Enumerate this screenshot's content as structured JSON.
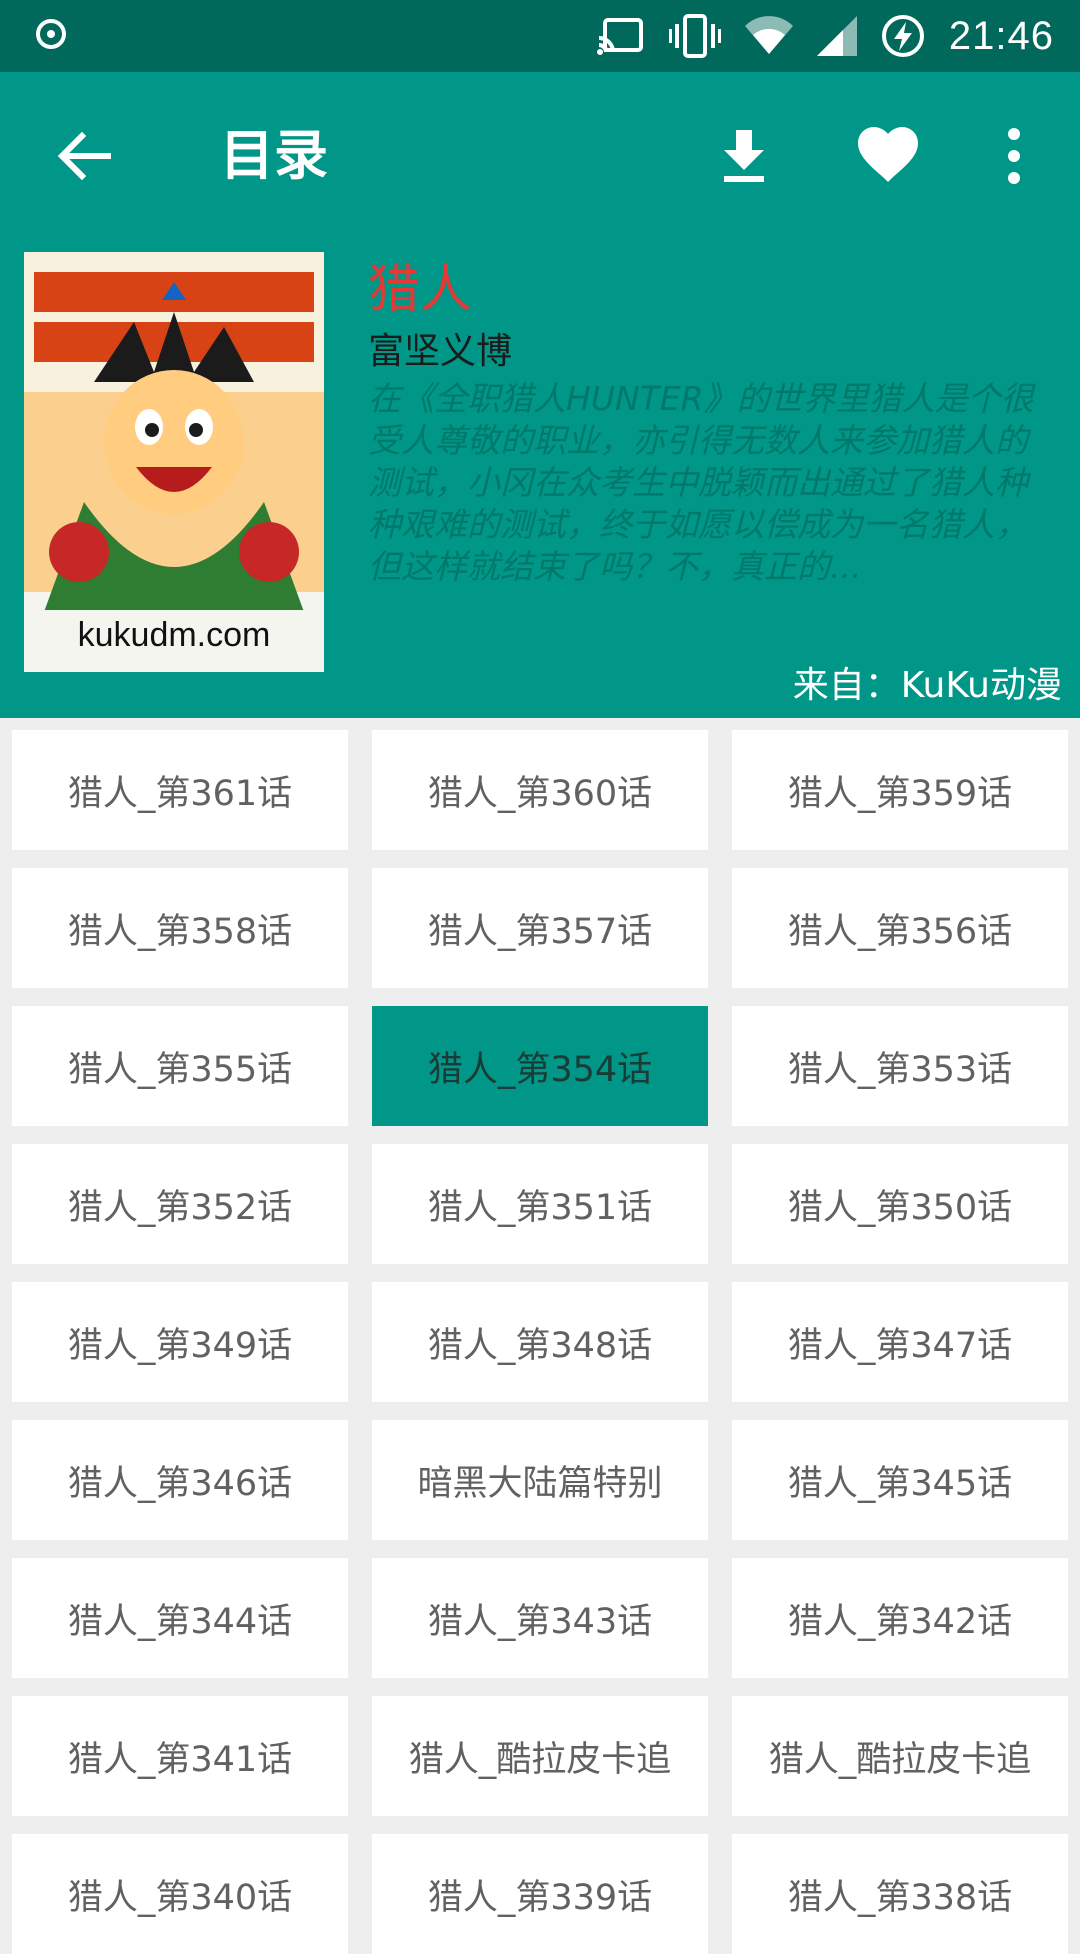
{
  "status_bar": {
    "time": "21:46",
    "icons": [
      "record-icon",
      "cast-icon",
      "vibrate-icon",
      "wifi-icon",
      "signal-icon",
      "battery-charging-icon"
    ]
  },
  "toolbar": {
    "title": "目录",
    "icons": [
      "back-arrow-icon",
      "download-icon",
      "heart-icon",
      "more-vert-icon"
    ]
  },
  "comic": {
    "cover_text": "kukudm.com",
    "title": "猎人",
    "author": "富坚义博",
    "description": "在《全职猎人HUNTER》的世界里猎人是个很受人尊敬的职业，亦引得无数人来参加猎人的测试，小冈在众考生中脱颖而出通过了猎人种种艰难的测试，终于如愿以偿成为一名猎人，但这样就结束了吗？不，真正的...",
    "source": "来自：KuKu动漫"
  },
  "colors": {
    "primary": "#009688",
    "primary_dark": "#00695c",
    "title_red": "#e53935"
  },
  "chapters": [
    {
      "label": "猎人_第361话",
      "active": false
    },
    {
      "label": "猎人_第360话",
      "active": false
    },
    {
      "label": "猎人_第359话",
      "active": false
    },
    {
      "label": "猎人_第358话",
      "active": false
    },
    {
      "label": "猎人_第357话",
      "active": false
    },
    {
      "label": "猎人_第356话",
      "active": false
    },
    {
      "label": "猎人_第355话",
      "active": false
    },
    {
      "label": "猎人_第354话",
      "active": true
    },
    {
      "label": "猎人_第353话",
      "active": false
    },
    {
      "label": "猎人_第352话",
      "active": false
    },
    {
      "label": "猎人_第351话",
      "active": false
    },
    {
      "label": "猎人_第350话",
      "active": false
    },
    {
      "label": "猎人_第349话",
      "active": false
    },
    {
      "label": "猎人_第348话",
      "active": false
    },
    {
      "label": "猎人_第347话",
      "active": false
    },
    {
      "label": "猎人_第346话",
      "active": false
    },
    {
      "label": "暗黑大陆篇特别",
      "active": false
    },
    {
      "label": "猎人_第345话",
      "active": false
    },
    {
      "label": "猎人_第344话",
      "active": false
    },
    {
      "label": "猎人_第343话",
      "active": false
    },
    {
      "label": "猎人_第342话",
      "active": false
    },
    {
      "label": "猎人_第341话",
      "active": false
    },
    {
      "label": "猎人_酷拉皮卡追",
      "active": false
    },
    {
      "label": "猎人_酷拉皮卡追",
      "active": false
    },
    {
      "label": "猎人_第340话",
      "active": false
    },
    {
      "label": "猎人_第339话",
      "active": false
    },
    {
      "label": "猎人_第338话",
      "active": false
    }
  ]
}
